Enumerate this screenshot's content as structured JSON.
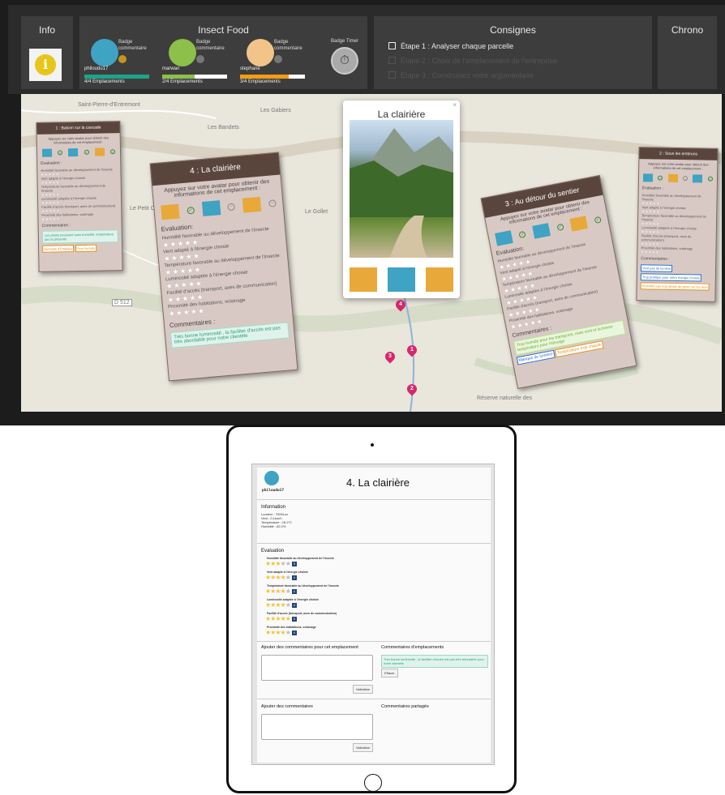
{
  "topbar": {
    "info_title": "Info",
    "info_icon": "i",
    "food_title": "Insect Food",
    "consignes_title": "Consignes",
    "chrono_title": "Chrono",
    "timer_label": "Badge Timer",
    "players": [
      {
        "name": "philoudu17",
        "badge": "Badge commentaire",
        "count": "4/4 Emplacements",
        "progress": 1.0,
        "color": "#1aa58a"
      },
      {
        "name": "marwan",
        "badge": "Badge commentaire",
        "count": "2/4 Emplacements",
        "progress": 0.5,
        "color": "#8cc04a"
      },
      {
        "name": "stephane",
        "badge": "Badge commentaire",
        "count": "3/4 Emplacements",
        "progress": 0.75,
        "color": "#f39c12"
      }
    ],
    "steps": [
      {
        "label": "Étape 1 : Analyser chaque parcelle",
        "active": true
      },
      {
        "label": "Étape 2 : Choix de l'emplacement de l'entreprise",
        "active": false
      },
      {
        "label": "Étape 3 : Construisez votre argumentaire",
        "active": false
      }
    ]
  },
  "map": {
    "labels": [
      "Saint-Pierre-d'Entremont",
      "Les Gabiers",
      "Les Bandets",
      "Le Petit Chenevey",
      "Le Gollet",
      "D 512",
      "Réserve naturelle des"
    ],
    "pins": [
      "4",
      "1",
      "3",
      "2"
    ]
  },
  "card1": {
    "title": "1 : Balcon sur la cascade",
    "sub": "Appuyez sur votre avatar pour obtenir des informations de cet emplacement :",
    "eval": "Evaluation :",
    "criteria": [
      "Humidité favorable au développement de l'insecte",
      "Vent adapté à l'énergie choisie",
      "Température favorable au développement de l'insecte",
      "Luminosité adaptée à l'énergie choisie",
      "Facilité d'accès (transport, axes de communication)",
      "Proximité des habitations, voisinage"
    ],
    "comments": "Commentaires :",
    "comment": "Les plants poussent sans humidité, température pas la présente",
    "tags": [
      "Humidité d'Emplace",
      "Trop humide"
    ]
  },
  "card2": {
    "title": "4 : La clairière",
    "sub": "Appuyez sur votre avatar pour obtenir des informations de cet emplacement :",
    "eval": "Evaluation:",
    "criteria": [
      "Humidité favorable au développement de l'insecte",
      "Vent adapté à l'énergie choisie",
      "Température favorable au développement de l'insecte",
      "Luminosité adaptée à l'énergie choisie",
      "Facilité d'accès (transport, axes de communication)",
      "Proximité des habitations, voisinage"
    ],
    "comments": "Commentaires :",
    "comment": "Très bonne luminosité , la faciliter d'accès est pas très abordable pour notre clientèle"
  },
  "card3": {
    "title": "3 : Au détour du sentier",
    "sub": "Appuyez sur votre avatar pour obtenir des informations de cet emplacement :",
    "eval": "Evaluation:",
    "criteria": [
      "Humidité favorable au développement de l'insecte",
      "Vent adapté à l'énergie choisie",
      "Température favorable au développement de l'insecte",
      "Luminosité adaptée à l'énergie choisie",
      "Facilité d'accès (transport, axes de communication)",
      "Proximité des habitations, voisinage"
    ],
    "comments": "Commentaires :",
    "comment": "Trop humide pour les transports, mais vent et la bonne température pour l'élevage",
    "tags": [
      "Manque de lumière",
      "Température trop chaude"
    ]
  },
  "card4": {
    "title": "2 : Sous les embruns",
    "sub": "Appuyez sur votre avatar pour obtenir des informations de cet emplacement :",
    "eval": "Evaluation :",
    "criteria": [
      "Humidité favorable au développement de l'insecte",
      "Vent adapté à l'énergie choisie",
      "Température favorable au développement de l'insecte",
      "Luminosité adaptée à l'énergie choisie",
      "Facilité d'accès (transport, axes de communication)",
      "Proximité des habitations, voisinage"
    ],
    "comments": "Commentaires :",
    "tags": [
      "Vent pas de lumière",
      "Trop pratique pour notre énergie choisie",
      "Humidité pas trop idéale de gérer sur les lieux"
    ]
  },
  "popup": {
    "title": "La clairière",
    "close": "×"
  },
  "tablet": {
    "username": "philoudu17",
    "title": "4. La clairière",
    "info_title": "Information",
    "info_lines": [
      "Lumière : 7000Lux",
      "Vent : 0.1km/h",
      "Température : 18.2°C",
      "Humidité : 82.2%"
    ],
    "eval_title": "Evaluation",
    "criteria": [
      {
        "label": "Humidité favorable au développement de l'insecte",
        "stars": 3,
        "score": "3"
      },
      {
        "label": "Vent adapté à l'énergie choisie",
        "stars": 4,
        "score": "4"
      },
      {
        "label": "Température favorable au développement de l'insecte",
        "stars": 4,
        "score": "4"
      },
      {
        "label": "Luminosité adaptée à l'énergie choisie",
        "stars": 4,
        "score": "4"
      },
      {
        "label": "Facilité d'accès (transport, axes de communication)",
        "stars": 5,
        "score": "5"
      },
      {
        "label": "Proximité des habitations, voisinage",
        "stars": 4,
        "score": "4"
      }
    ],
    "add_comments_place": "Ajouter des commentaires pour cet emplacement",
    "place_comments": "Commentaires d'emplacements",
    "place_comment": "Très bonne luminosité , la faciliter d'accès est pas très abordable pour notre clientèle",
    "erase": "Effacer",
    "validate": "Validation",
    "add_comments": "Ajouter des commentaires",
    "shared_comments": "Commentaires partagés"
  }
}
